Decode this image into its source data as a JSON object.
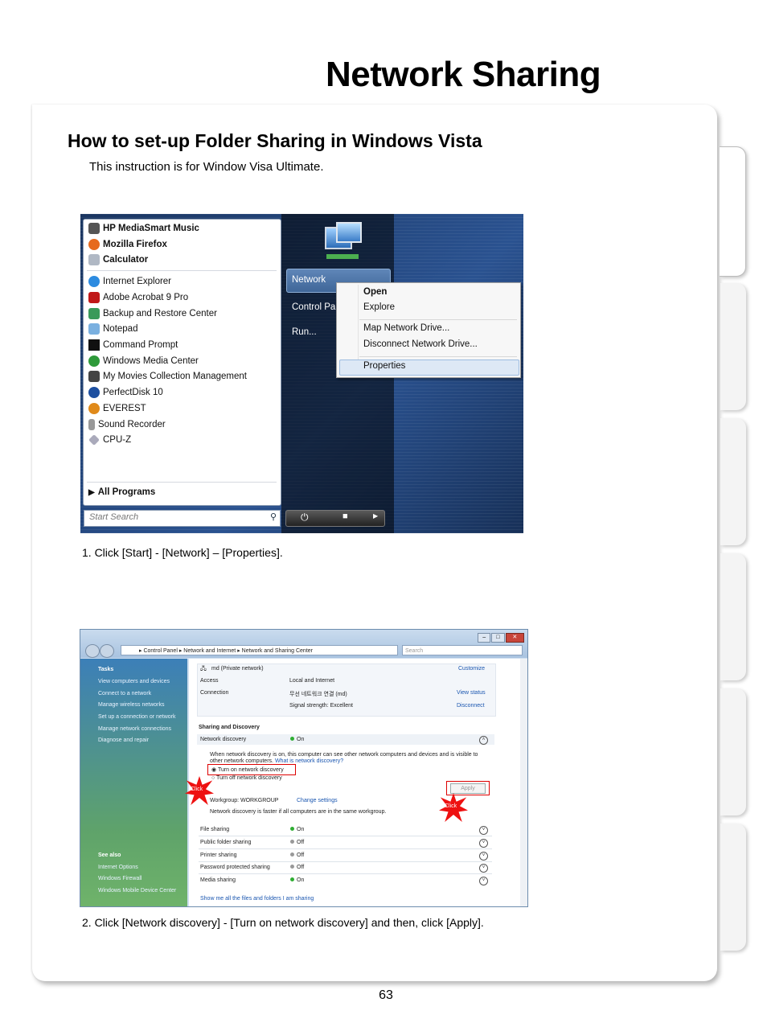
{
  "page": {
    "title": "Network Sharing",
    "heading": "How to set-up Folder Sharing in Windows Vista",
    "intro": "This instruction is for Window Visa Ultimate.",
    "step1": "1. Click [Start] - [Network] – [Properties].",
    "step2": "2. Click [Network discovery] - [Turn on network discovery] and then, click [Apply].",
    "page_number": "63"
  },
  "start_menu": {
    "pinned": [
      "HP MediaSmart Music",
      "Mozilla Firefox",
      "Calculator"
    ],
    "recent": [
      "Internet Explorer",
      "Adobe Acrobat 9 Pro",
      "Backup and Restore Center",
      "Notepad",
      "Command Prompt",
      "Windows Media Center",
      "My Movies Collection Management",
      "PerfectDisk 10",
      "EVEREST",
      "Sound Recorder",
      "CPU-Z"
    ],
    "all_programs": "All Programs",
    "search_placeholder": "Start Search",
    "right": {
      "network": "Network",
      "control_panel": "Control Pa",
      "run": "Run..."
    },
    "context_menu": {
      "open": "Open",
      "explore": "Explore",
      "map": "Map Network Drive...",
      "disconnect": "Disconnect Network Drive...",
      "properties": "Properties"
    }
  },
  "nsc": {
    "address": "▸ Control Panel ▸ Network and Internet ▸ Network and Sharing Center",
    "search": "Search",
    "tasks_title": "Tasks",
    "tasks": [
      "View computers and devices",
      "Connect to a network",
      "Manage wireless networks",
      "Set up a connection or network",
      "Manage network connections",
      "Diagnose and repair"
    ],
    "see_also_title": "See also",
    "see_also": [
      "Internet Options",
      "Windows Firewall",
      "Windows Mobile Device Center"
    ],
    "network_name": "md (Private network)",
    "customize": "Customize",
    "access_label": "Access",
    "access_value": "Local and Internet",
    "connection_label": "Connection",
    "connection_value": "무선 네트워크 연결 (md)",
    "view_status": "View status",
    "signal": "Signal strength:  Excellent",
    "disconnect": "Disconnect",
    "sharing_title": "Sharing and Discovery",
    "network_discovery": "Network discovery",
    "on": "On",
    "off": "Off",
    "discovery_desc": "When network discovery is on, this computer can see other network computers and devices and is visible to other network computers.",
    "what_is": "What is network discovery?",
    "turn_on": "Turn on network discovery",
    "turn_off": "Turn off network discovery",
    "apply": "Apply",
    "workgroup": "Workgroup: WORKGROUP",
    "change_settings": "Change settings",
    "faster": "Network discovery is faster if all computers are in the same workgroup.",
    "file_sharing": "File sharing",
    "public_folder": "Public folder sharing",
    "printer_sharing": "Printer sharing",
    "password_sharing": "Password protected sharing",
    "media_sharing": "Media sharing",
    "show_all": "Show me all the files and folders I am sharing",
    "click": "Click"
  }
}
